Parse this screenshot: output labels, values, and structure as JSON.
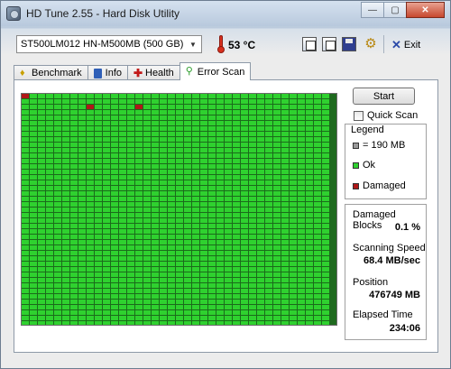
{
  "window": {
    "title": "HD Tune 2.55 - Hard Disk Utility",
    "controls": {
      "minimize": "—",
      "maximize": "▢",
      "close": "✕"
    }
  },
  "toolbar": {
    "drive": "ST500LM012 HN-M500MB (500 GB)",
    "temperature": "53 °C",
    "exit_label": "Exit",
    "icons": [
      "copy-text-icon",
      "copy-screenshot-icon",
      "save-icon",
      "options-icon",
      "exit-icon"
    ]
  },
  "tabs": [
    {
      "label": "Benchmark",
      "icon": "benchmark-icon",
      "active": false
    },
    {
      "label": "Info",
      "icon": "info-icon",
      "active": false
    },
    {
      "label": "Health",
      "icon": "health-icon",
      "active": false
    },
    {
      "label": "Error Scan",
      "icon": "magnifier-icon",
      "active": true
    }
  ],
  "scan": {
    "start_label": "Start",
    "quick_scan_label": "Quick Scan",
    "quick_scan_checked": false,
    "block_grid": {
      "columns": 38,
      "rows": 43,
      "damaged_blocks": [
        [
          0,
          0
        ],
        [
          2,
          8
        ],
        [
          2,
          14
        ]
      ]
    }
  },
  "legend": {
    "title": "Legend",
    "items": [
      {
        "label": "= 190 MB",
        "color": "#9a9a9a"
      },
      {
        "label": "Ok",
        "color": "#2fd12f"
      },
      {
        "label": "Damaged",
        "color": "#b01818"
      }
    ]
  },
  "stats": {
    "damaged_blocks_label": "Damaged Blocks",
    "damaged_blocks_value": "0.1 %",
    "scanning_speed_label": "Scanning Speed",
    "scanning_speed_value": "68.4 MB/sec",
    "position_label": "Position",
    "position_value": "476749 MB",
    "elapsed_time_label": "Elapsed Time",
    "elapsed_time_value": "234:06"
  }
}
